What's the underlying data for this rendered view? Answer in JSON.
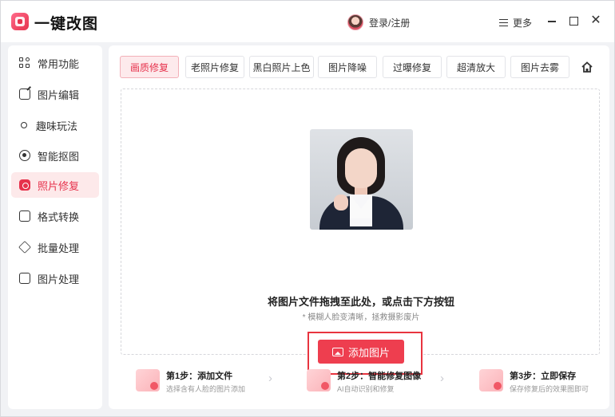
{
  "app": {
    "title": "一键改图",
    "login_label": "登录/注册",
    "more_label": "更多",
    "close_glyph": "✕"
  },
  "sidebar": {
    "items": [
      {
        "label": "常用功能",
        "icon": "grid-icon",
        "active": false
      },
      {
        "label": "图片编辑",
        "icon": "edit-icon",
        "active": false
      },
      {
        "label": "趣味玩法",
        "icon": "magic-icon",
        "active": false
      },
      {
        "label": "智能抠图",
        "icon": "target-icon",
        "active": false
      },
      {
        "label": "照片修复",
        "icon": "photo-repair-icon",
        "active": true
      },
      {
        "label": "格式转换",
        "icon": "convert-icon",
        "active": false
      },
      {
        "label": "批量处理",
        "icon": "layers-icon",
        "active": false
      },
      {
        "label": "图片处理",
        "icon": "image-process-icon",
        "active": false
      }
    ]
  },
  "tabs": [
    {
      "label": "画质修复",
      "active": true
    },
    {
      "label": "老照片修复",
      "active": false
    },
    {
      "label": "黑白照片上色",
      "active": false
    },
    {
      "label": "图片降噪",
      "active": false
    },
    {
      "label": "过曝修复",
      "active": false
    },
    {
      "label": "超清放大",
      "active": false
    },
    {
      "label": "图片去雾",
      "active": false
    }
  ],
  "dropzone": {
    "title": "将图片文件拖拽至此处，或点击下方按钮",
    "subtitle": "* 模糊人脸变清晰，拯救摄影废片",
    "button_label": "添加图片"
  },
  "steps": [
    {
      "title": "第1步：添加文件",
      "desc": "选择含有人脸的图片添加"
    },
    {
      "title": "第2步：智能修复图像",
      "desc": "AI自动识别和修复"
    },
    {
      "title": "第3步：立即保存",
      "desc": "保存修复后的效果图即可"
    }
  ],
  "colors": {
    "accent": "#ee3e4f",
    "active_bg": "#fdeaec"
  }
}
